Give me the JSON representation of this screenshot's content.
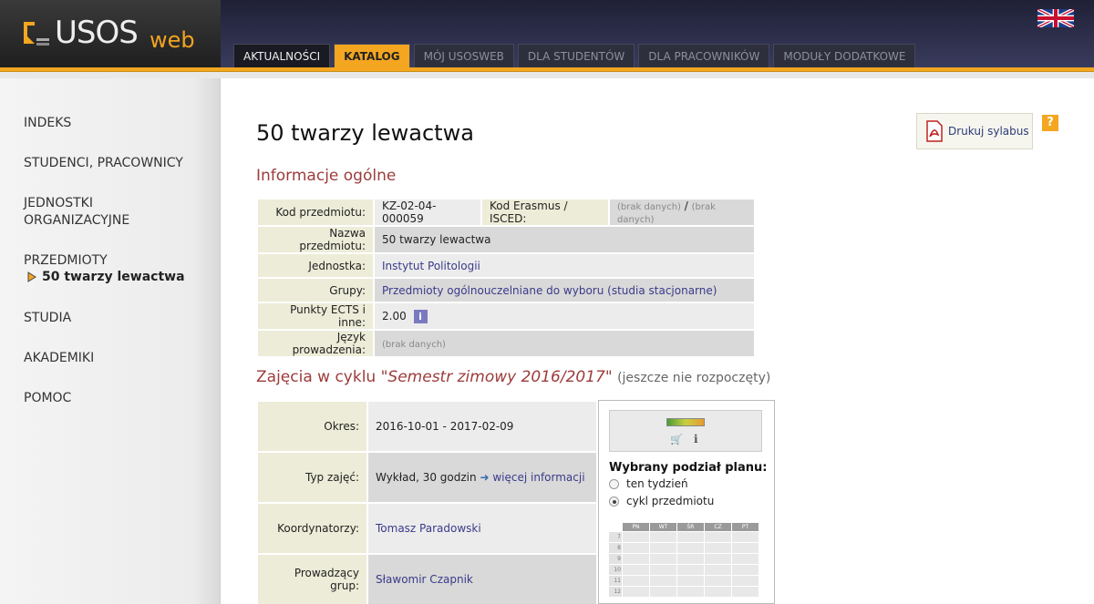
{
  "brand": {
    "logo_main": "USOS",
    "logo_sub": "web"
  },
  "colors": {
    "accent": "#f4a620",
    "header_bg": "#2b2d4a",
    "section_title": "#9d3b3b",
    "link": "#3a3a8a"
  },
  "tabs": [
    {
      "label": "AKTUALNOŚCI",
      "state": "normal"
    },
    {
      "label": "KATALOG",
      "state": "active"
    },
    {
      "label": "MÓJ USOSWEB",
      "state": "disabled"
    },
    {
      "label": "DLA STUDENTÓW",
      "state": "disabled"
    },
    {
      "label": "DLA PRACOWNIKÓW",
      "state": "disabled"
    },
    {
      "label": "MODUŁY DODATKOWE",
      "state": "disabled"
    }
  ],
  "sidebar": {
    "items": [
      {
        "label": "INDEKS"
      },
      {
        "label": "STUDENCI, PRACOWNICY"
      },
      {
        "label": "JEDNOSTKI ORGANIZACYJNE"
      },
      {
        "label": "PRZEDMIOTY"
      },
      {
        "label": "STUDIA"
      },
      {
        "label": "AKADEMIKI"
      },
      {
        "label": "POMOC"
      }
    ],
    "current_sub": "50 twarzy lewactwa"
  },
  "main": {
    "title": "50 twarzy lewactwa",
    "print_label": "Drukuj sylabus",
    "help_label": "?",
    "section1": "Informacje ogólne",
    "info": {
      "kod_label": "Kod przedmiotu:",
      "kod_value": "KZ-02-04-000059",
      "erasmus_label": "Kod Erasmus / ISCED:",
      "erasmus_value1": "(brak danych)",
      "erasmus_sep": "/",
      "erasmus_value2": "(brak danych)",
      "nazwa_label": "Nazwa przedmiotu:",
      "nazwa_value": "50 twarzy lewactwa",
      "jednostka_label": "Jednostka:",
      "jednostka_value": "Instytut Politologii",
      "grupy_label": "Grupy:",
      "grupy_value": "Przedmioty ogólnouczelniane do wyboru (studia stacjonarne)",
      "ects_label": "Punkty ECTS i inne:",
      "ects_value": "2.00",
      "ects_badge": "i",
      "jezyk_label": "Język prowadzenia:",
      "jezyk_value": "(brak danych)"
    },
    "section2_prefix": "Zajęcia w cyklu",
    "section2_cycle": "\"Semestr zimowy 2016/2017\"",
    "section2_note": "(jeszcze nie rozpoczęty)",
    "cycle": {
      "okres_label": "Okres:",
      "okres_value": "2016-10-01 - 2017-02-09",
      "typ_label": "Typ zajęć:",
      "typ_value": "Wykład, 30 godzin",
      "typ_arrow": "➜",
      "typ_link": "więcej informacji",
      "koord_label": "Koordynatorzy:",
      "koord_value": "Tomasz Paradowski",
      "prow_label": "Prowadzący grup:",
      "prow_value": "Sławomir Czapnik"
    },
    "plan": {
      "icons": [
        "cart-icon",
        "info-icon"
      ],
      "title": "Wybrany podział planu:",
      "options": [
        {
          "label": "ten tydzień",
          "selected": false
        },
        {
          "label": "cykl przedmiotu",
          "selected": true
        }
      ],
      "days": [
        "PN",
        "WT",
        "ŚR",
        "CZ",
        "PT"
      ],
      "hours": [
        "7",
        "8",
        "9",
        "10",
        "11",
        "12"
      ]
    }
  }
}
